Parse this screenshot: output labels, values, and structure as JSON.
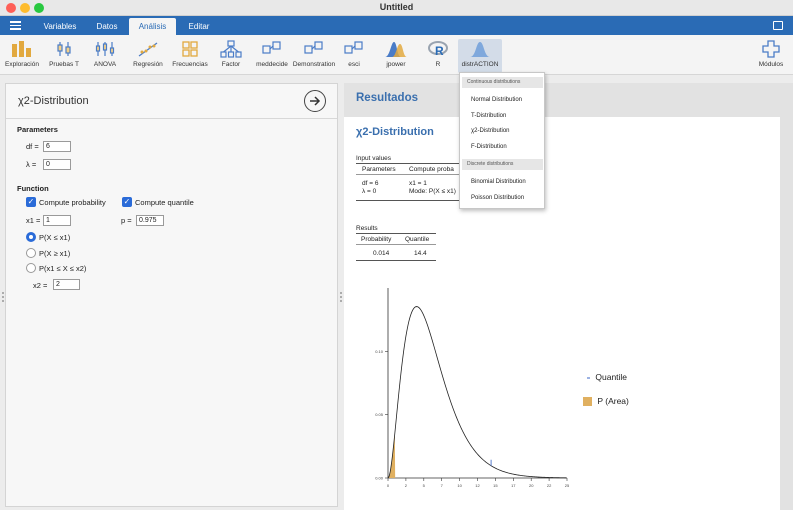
{
  "window": {
    "title": "Untitled"
  },
  "tabs": [
    "Variables",
    "Datos",
    "Análisis",
    "Editar"
  ],
  "ribbon": {
    "items": [
      "Exploración",
      "Pruebas T",
      "ANOVA",
      "Regresión",
      "Frecuencias",
      "Factor",
      "meddecide",
      "Demonstration",
      "esci",
      "jpower",
      "R",
      "distrACTION"
    ],
    "modules": "Módulos"
  },
  "left": {
    "title": "χ2-Distribution",
    "parameters_head": "Parameters",
    "df_label": "df =",
    "df_value": "6",
    "lambda_label": "λ =",
    "lambda_value": "0",
    "function_head": "Function",
    "compute_probability": "Compute probability",
    "compute_quantile": "Compute quantile",
    "x1_label": "x1 =",
    "x1_value": "1",
    "p_label": "p =",
    "p_value": "0.975",
    "radio1": "P(X ≤ x1)",
    "radio2": "P(X ≥ x1)",
    "radio3": "P(x1 ≤ X ≤ x2)",
    "x2_label": "x2 =",
    "x2_value": "2"
  },
  "results": {
    "header": "Resultados",
    "title": "χ2-Distribution",
    "input_values": "Input values",
    "col_parameters": "Parameters",
    "col_compute": "Compute proba",
    "df_line": "df = 6",
    "lambda_line": "λ = 0",
    "x1_line": "x1 = 1",
    "mode_line": "Mode: P(X ≤ x1)",
    "results_label": "Results",
    "col_probability": "Probability",
    "col_quantile": "Quantile",
    "probability": "0.014",
    "quantile": "14.4"
  },
  "menu": {
    "continuous_head": "Continuous distributions",
    "continuous": [
      "Normal Distribution",
      "T-Distribution",
      "χ2-Distribution",
      "F-Distribution"
    ],
    "discrete_head": "Discrete distributions",
    "discrete": [
      "Binomial Distribution",
      "Poisson Distribution"
    ]
  },
  "chart_data": {
    "type": "line",
    "df": 6,
    "x_range": [
      0,
      25
    ],
    "y_range": [
      0,
      0.15
    ],
    "x_ticks": [
      "0",
      "2",
      "5",
      "7",
      "10",
      "12",
      "15",
      "17",
      "20",
      "22",
      "25"
    ],
    "y_ticks": [
      "0.00",
      "0.05",
      "0.10"
    ],
    "shaded_area_upper": 1,
    "quantile_marker": 14.4,
    "legend": [
      "Quantile",
      "P (Area)"
    ],
    "colors": {
      "area": "#e0b060",
      "quantile": "#5a7fd0",
      "curve": "#222222"
    }
  }
}
